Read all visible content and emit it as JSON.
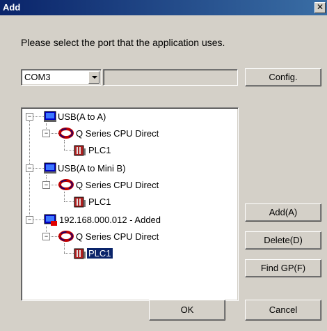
{
  "window": {
    "title": "Add",
    "close_glyph": "✕"
  },
  "instruction": "Please select the port that the application uses.",
  "port": {
    "selected": "COM3",
    "details": ""
  },
  "buttons": {
    "config": "Config.",
    "add": "Add(A)",
    "delete": "Delete(D)",
    "find": "Find GP(F)",
    "ok": "OK",
    "cancel": "Cancel"
  },
  "tree": {
    "nodes": [
      {
        "label": "USB(A to A)",
        "icon": "usb-port-icon"
      },
      {
        "label": "Q Series CPU Direct",
        "icon": "connection-loop-icon"
      },
      {
        "label": "PLC1",
        "icon": "plc-icon"
      },
      {
        "label": "USB(A to Mini B)",
        "icon": "usb-port-icon"
      },
      {
        "label": "Q Series CPU Direct",
        "icon": "connection-loop-icon"
      },
      {
        "label": "PLC1",
        "icon": "plc-icon"
      },
      {
        "label": "192.168.000.012 - Added",
        "icon": "network-added-icon"
      },
      {
        "label": "Q Series CPU Direct",
        "icon": "connection-loop-icon"
      },
      {
        "label": "PLC1",
        "icon": "plc-icon",
        "selected": true
      }
    ]
  }
}
